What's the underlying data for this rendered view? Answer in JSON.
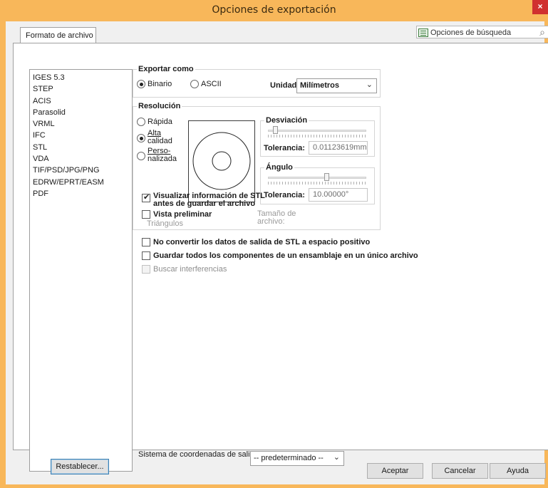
{
  "window": {
    "title": "Opciones de exportación",
    "close_glyph": "×"
  },
  "tab": {
    "label": "Formato de archivo"
  },
  "search": {
    "label": "Opciones de búsqueda"
  },
  "formats": [
    "IGES 5.3",
    "STEP",
    "ACIS",
    "Parasolid",
    "VRML",
    "IFC",
    "STL",
    "VDA",
    "TIF/PSD/JPG/PNG",
    "EDRW/EPRT/EASM",
    "PDF"
  ],
  "reset_button": "Restablecer...",
  "export_as": {
    "title": "Exportar como",
    "binary": "Binario",
    "ascii": "ASCII",
    "selected": "Binario",
    "unit_label": "Unidad",
    "unit_value": "Milímetros"
  },
  "resolution": {
    "title": "Resolución",
    "rapid": "Rápida",
    "high_1": "Alta",
    "high_2": "calidad",
    "custom_1": "Perso-",
    "custom_2": "nalizada",
    "selected": "Alta calidad",
    "deviation_title": "Desviación",
    "deviation_slider": 0.05,
    "tolerance_label": "Tolerancia:",
    "deviation_tolerance": "0.01123619mm",
    "angle_title": "Ángulo",
    "angle_slider": 0.6,
    "angle_tolerance": "10.00000°",
    "show_info_1": "Visualizar información de STL",
    "show_info_2": "antes de guardar el archivo",
    "show_info_checked": true,
    "preview_label": "Vista preliminar",
    "preview_checked": false,
    "triangles_label": "Triángulos",
    "file_size_1": "Tamaño de",
    "file_size_2": "archivo:"
  },
  "options": {
    "no_convert": "No convertir los datos de salida de STL a espacio positivo",
    "save_all": "Guardar todos los componentes de un ensamblaje en un único archivo",
    "check_interference": "Buscar interferencias"
  },
  "coord_system": {
    "label": "Sistema de coordenadas de salida:",
    "value": "-- predeterminado --"
  },
  "footer": {
    "accept": "Aceptar",
    "cancel": "Cancelar",
    "help": "Ayuda"
  }
}
